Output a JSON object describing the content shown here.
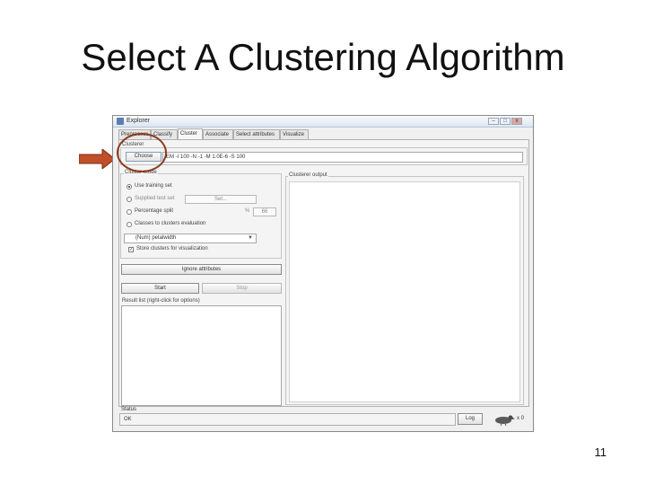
{
  "slide": {
    "title": "Select A Clustering Algorithm",
    "page_number": "11"
  },
  "window": {
    "title": "Explorer",
    "controls": {
      "minimize": "–",
      "maximize": "□",
      "close": "x"
    }
  },
  "tabs": [
    {
      "label": "Preprocess"
    },
    {
      "label": "Classify"
    },
    {
      "label": "Cluster"
    },
    {
      "label": "Associate"
    },
    {
      "label": "Select attributes"
    },
    {
      "label": "Visualize"
    }
  ],
  "clusterer": {
    "section_label": "Clusterer",
    "choose_label": "Choose",
    "algorithm": "EM -I 100 -N -1 -M 1.0E-6 -S 100"
  },
  "cluster_mode": {
    "section_label": "Cluster mode",
    "options": [
      {
        "label": "Use training set"
      },
      {
        "label": "Supplied test set"
      },
      {
        "label": "Percentage split"
      },
      {
        "label": "Classes to clusters evaluation"
      }
    ],
    "set_button": "Set...",
    "percent_sign": "%",
    "percent_value": "66",
    "class_select": "(Num) petalwidth",
    "store_clusters": "Store clusters for visualization"
  },
  "buttons": {
    "ignore_attributes": "Ignore attributes",
    "start": "Start",
    "stop": "Stop"
  },
  "result_list": {
    "label": "Result list (right-click for options)"
  },
  "output": {
    "label": "Clusterer output"
  },
  "status": {
    "label": "Status",
    "value": "OK",
    "log_button": "Log",
    "count": "x 0"
  },
  "colors": {
    "highlight": "#8b3d1e",
    "arrow": "#c0502a"
  }
}
